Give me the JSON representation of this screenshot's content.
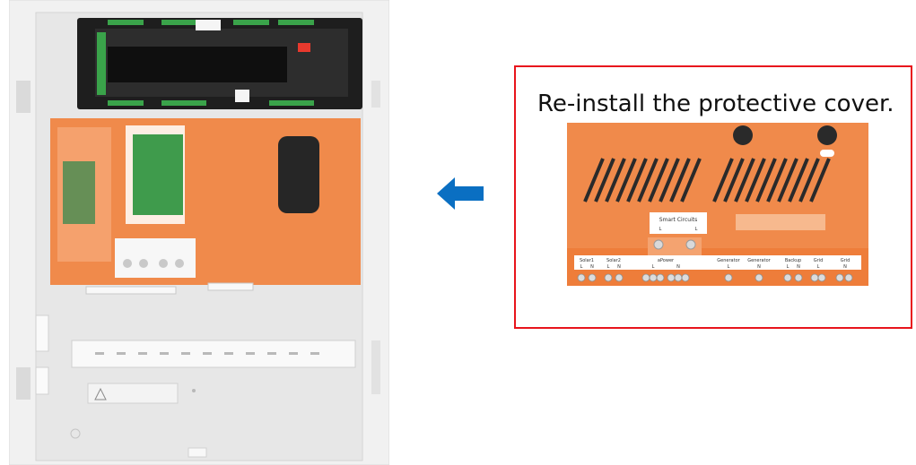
{
  "callout": {
    "instruction": "Re-install the protective cover."
  },
  "cover": {
    "center_label": "Smart Circuits",
    "center_sublabels": [
      "L",
      "L"
    ],
    "terminal_groups": [
      {
        "name": "Solar1",
        "subs": [
          "L",
          "N"
        ]
      },
      {
        "name": "Solar2",
        "subs": [
          "L",
          "N"
        ]
      },
      {
        "name": "aPower",
        "subs": [
          "L",
          "N"
        ]
      },
      {
        "name": "Generator",
        "subs": [
          "L"
        ]
      },
      {
        "name": "Generator",
        "subs": [
          "N"
        ]
      },
      {
        "name": "Backup",
        "subs": [
          "L",
          "N"
        ]
      },
      {
        "name": "Grid",
        "subs": [
          "L"
        ]
      },
      {
        "name": "Grid",
        "subs": [
          "N"
        ]
      }
    ]
  },
  "colors": {
    "accent_red": "#e8141c",
    "arrow_blue": "#0a6fc2",
    "cover_orange": "#f08a4b",
    "cabinet_gray": "#e9e9e9"
  },
  "icons": {
    "arrow": "arrow-left-icon"
  }
}
